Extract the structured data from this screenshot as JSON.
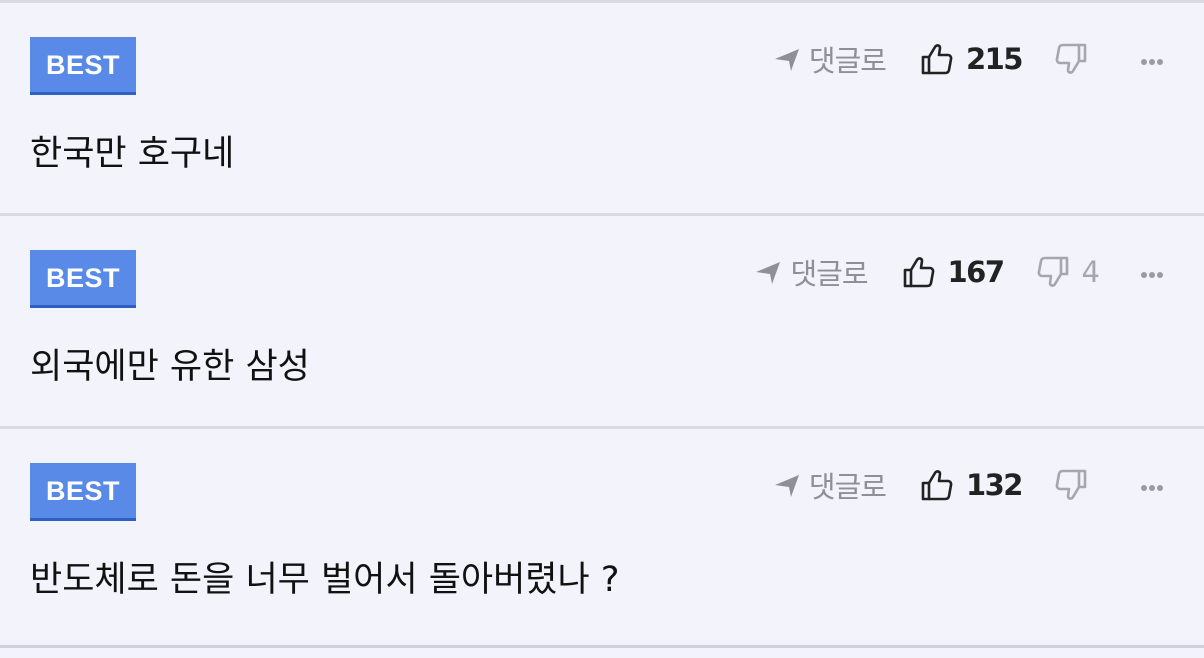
{
  "comments": [
    {
      "badge": "BEST",
      "text": "한국만 호구네",
      "reply_label": "댓글로",
      "likes": "215",
      "dislikes": ""
    },
    {
      "badge": "BEST",
      "text": "외국에만 유한 삼성",
      "reply_label": "댓글로",
      "likes": "167",
      "dislikes": "4"
    },
    {
      "badge": "BEST",
      "text": "반도체로 돈을 너무 벌어서 돌아버렸나 ?",
      "reply_label": "댓글로",
      "likes": "132",
      "dislikes": ""
    }
  ],
  "icons": {
    "reply": "reply-arrow-icon",
    "like": "thumbs-up-icon",
    "dislike": "thumbs-down-icon",
    "more": "more-dots-icon"
  },
  "colors": {
    "badge_bg": "#5a8ae8",
    "page_bg": "#f2f3fb"
  }
}
